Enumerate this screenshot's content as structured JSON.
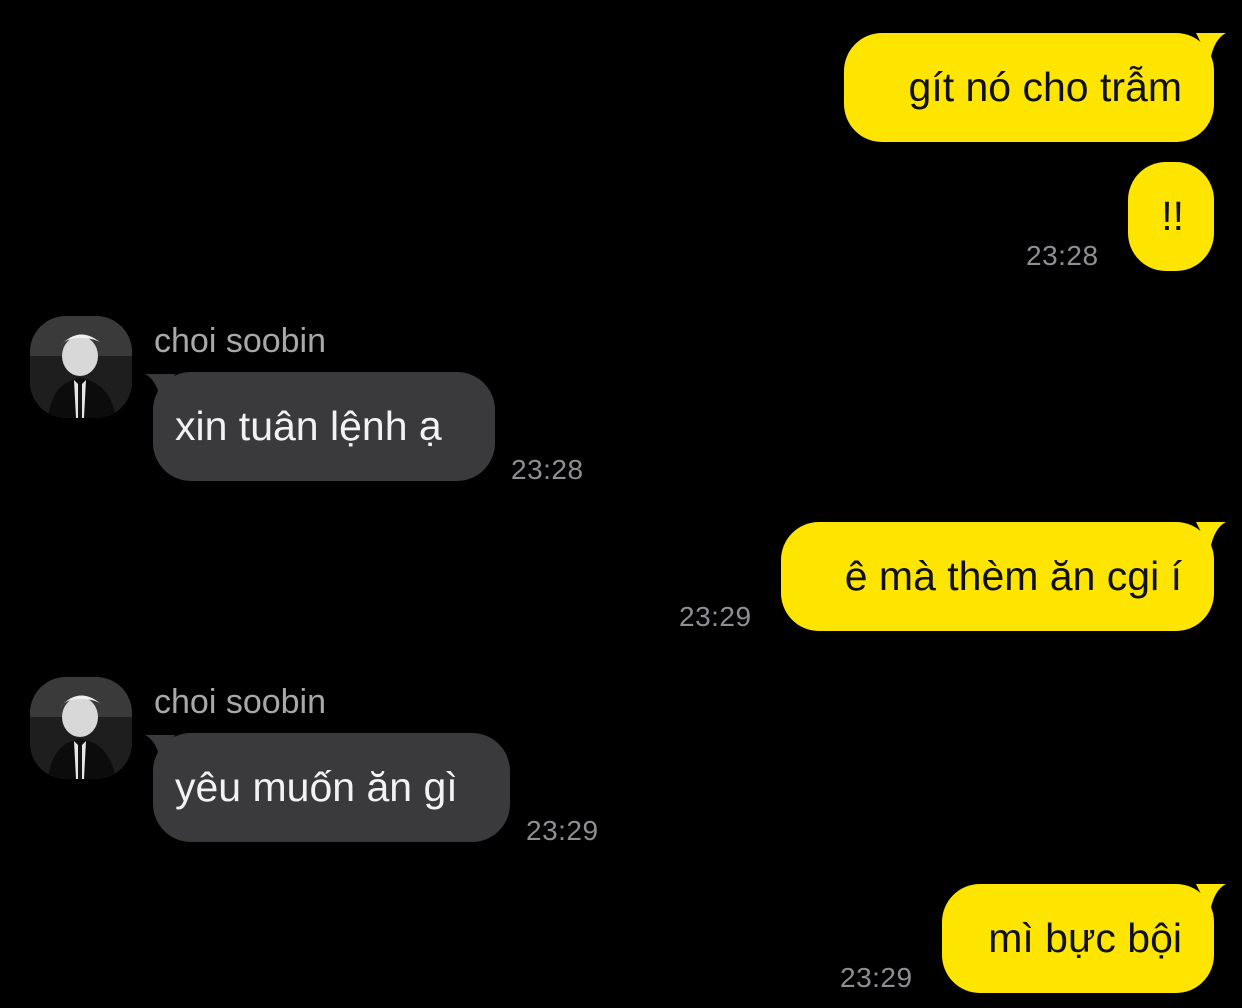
{
  "colors": {
    "background": "#000000",
    "my_bubble": "#FEE500",
    "their_bubble": "#3A3A3C",
    "timestamp": "#8E8E93",
    "sender_name": "#A8A8A8"
  },
  "messages": [
    {
      "from": "me",
      "text": "gít nó cho trẫm",
      "time": ""
    },
    {
      "from": "me",
      "text": "!!",
      "time": "23:28"
    },
    {
      "from": "them",
      "sender": "choi soobin",
      "text": "xin tuân lệnh ạ",
      "time": "23:28"
    },
    {
      "from": "me",
      "text": "ê mà thèm ăn cgi í",
      "time": "23:29"
    },
    {
      "from": "them",
      "sender": "choi soobin",
      "text": "yêu muốn ăn gì",
      "time": "23:29"
    },
    {
      "from": "me",
      "text": "mì bực bội",
      "time": "23:29"
    }
  ],
  "avatar_icon": "profile-photo-icon"
}
